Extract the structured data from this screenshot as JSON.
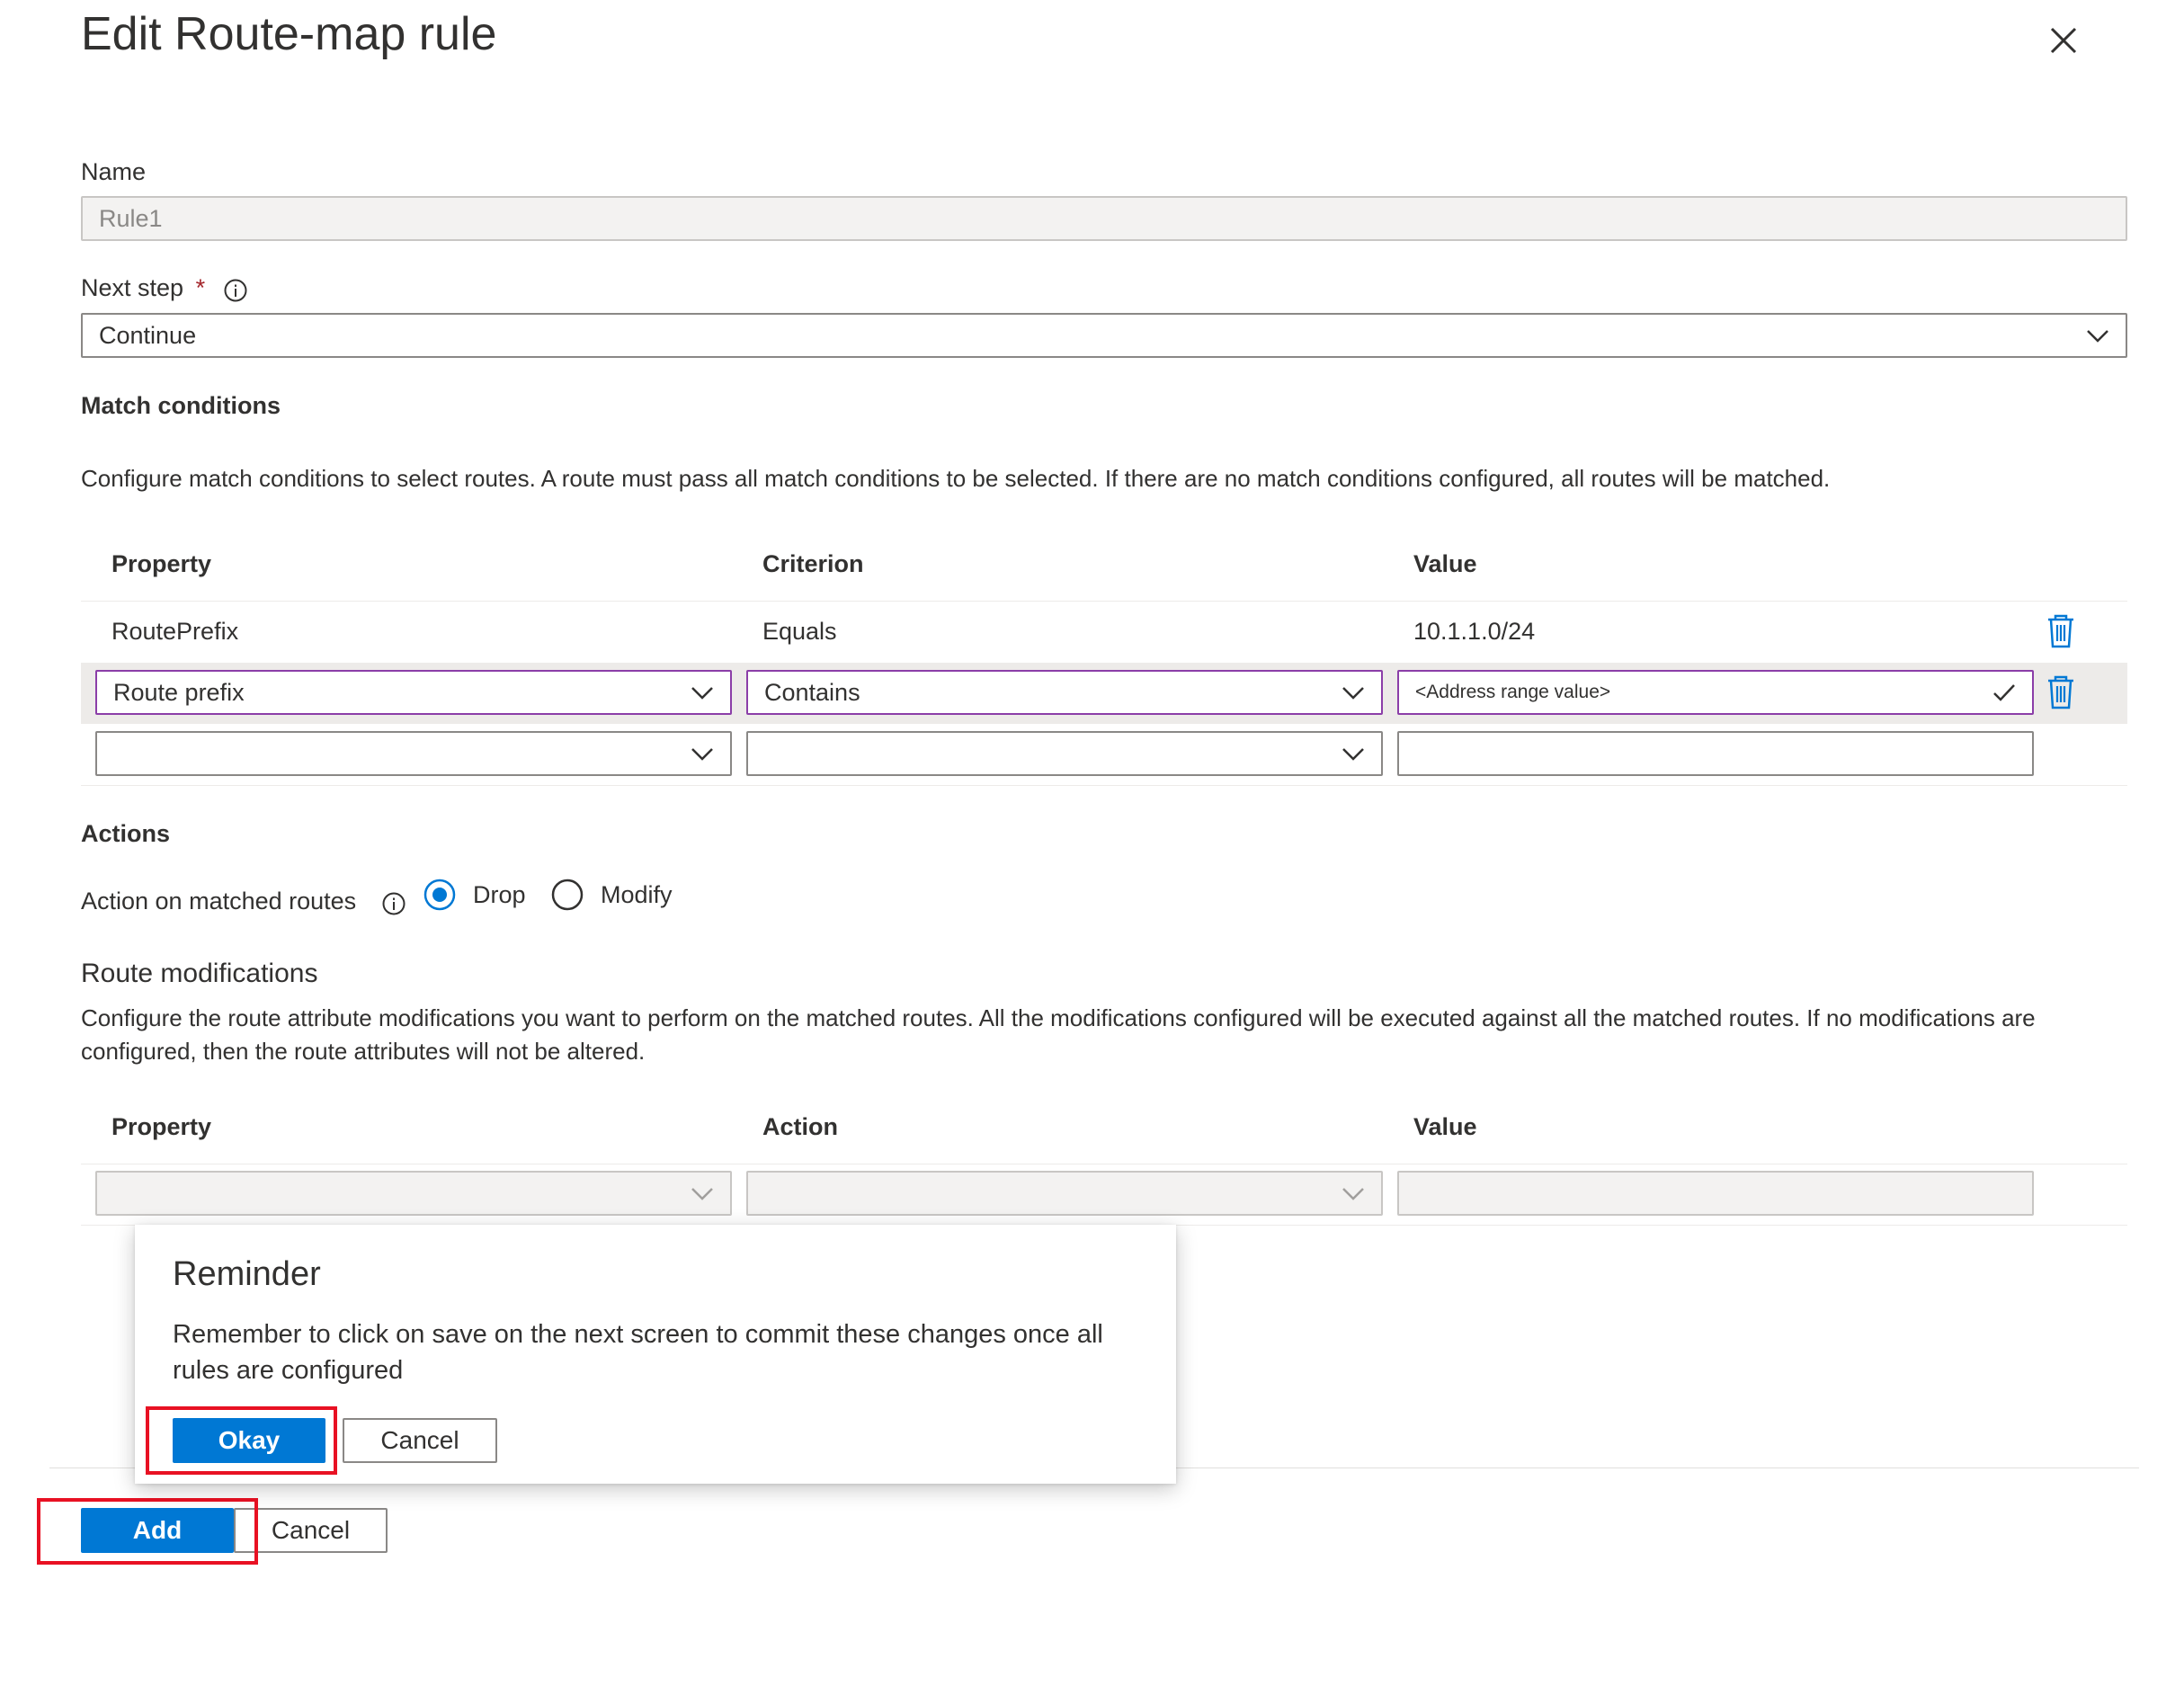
{
  "panel": {
    "title": "Edit Route-map rule",
    "close_icon": "close-icon"
  },
  "name_field": {
    "label": "Name",
    "value": "Rule1"
  },
  "next_step": {
    "label": "Next step",
    "required_mark": "*",
    "value": "Continue"
  },
  "match_conditions": {
    "heading": "Match conditions",
    "description": "Configure match conditions to select routes. A route must pass all match conditions to be selected. If there are no match conditions configured, all routes will be matched.",
    "columns": [
      "Property",
      "Criterion",
      "Value"
    ],
    "rows": [
      {
        "property": "RoutePrefix",
        "criterion": "Equals",
        "value": "10.1.1.0/24"
      }
    ],
    "edit_row": {
      "property": "Route prefix",
      "criterion": "Contains",
      "value": "<Address range value>"
    }
  },
  "actions": {
    "heading": "Actions",
    "label": "Action on matched routes",
    "options": [
      {
        "label": "Drop",
        "selected": true
      },
      {
        "label": "Modify",
        "selected": false
      }
    ]
  },
  "route_modifications": {
    "heading": "Route modifications",
    "description": "Configure the route attribute modifications you want to perform on the matched routes. All the modifications configured will be executed against all the matched routes. If no modifications are configured, then the route attributes will not be altered.",
    "columns": [
      "Property",
      "Action",
      "Value"
    ]
  },
  "reminder": {
    "title": "Reminder",
    "message": "Remember to click on save on the next screen to commit these changes once all rules are configured",
    "okay_label": "Okay",
    "cancel_label": "Cancel"
  },
  "footer": {
    "add_label": "Add",
    "cancel_label": "Cancel"
  },
  "colors": {
    "accent": "#0078d4",
    "highlight": "#e81123",
    "edit_border": "#8b3ea8",
    "required": "#a4262c"
  }
}
